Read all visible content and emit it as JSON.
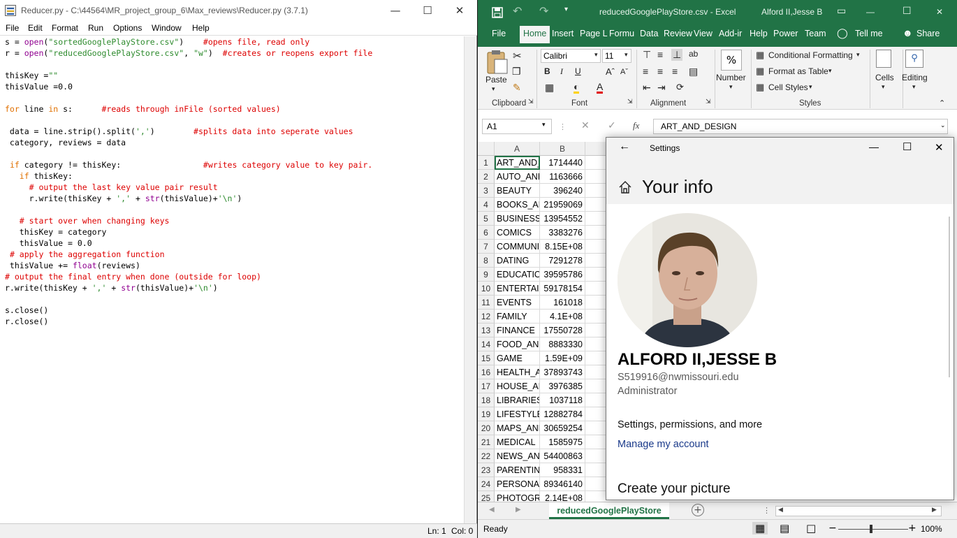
{
  "idle": {
    "title": "Reducer.py - C:\\44564\\MR_project_group_6\\Max_reviews\\Reducer.py (3.7.1)",
    "menu": [
      "File",
      "Edit",
      "Format",
      "Run",
      "Options",
      "Window",
      "Help"
    ],
    "status_ln": "Ln: 1",
    "status_col": "Col: 0",
    "code": [
      [
        [
          "s = ",
          ""
        ],
        [
          "open",
          "bi"
        ],
        [
          "(",
          ""
        ],
        [
          "\"sortedGooglePlayStore.csv\"",
          "str"
        ],
        [
          ")    ",
          ""
        ],
        [
          "#opens file, read only",
          "cmt"
        ]
      ],
      [
        [
          "r = ",
          ""
        ],
        [
          "open",
          "bi"
        ],
        [
          "(",
          ""
        ],
        [
          "\"reducedGooglePlayStore.csv\"",
          "str"
        ],
        [
          ", ",
          ""
        ],
        [
          "\"w\"",
          "str"
        ],
        [
          ")  ",
          ""
        ],
        [
          "#creates or reopens export file",
          "cmt"
        ]
      ],
      [],
      [
        [
          "thisKey =",
          ""
        ],
        [
          "\"\"",
          "str"
        ]
      ],
      [
        [
          "thisValue =0.0",
          ""
        ]
      ],
      [],
      [
        [
          "for",
          "kw"
        ],
        [
          " line ",
          ""
        ],
        [
          "in",
          "kw"
        ],
        [
          " s:      ",
          ""
        ],
        [
          "#reads through inFile (sorted values)",
          "cmt"
        ]
      ],
      [],
      [
        [
          " data = line.strip().split(",
          ""
        ],
        [
          "','",
          "str"
        ],
        [
          ")        ",
          ""
        ],
        [
          "#splits data into seperate values",
          "cmt"
        ]
      ],
      [
        [
          " category, reviews = data",
          ""
        ]
      ],
      [],
      [
        [
          " ",
          ""
        ],
        [
          "if",
          "kw"
        ],
        [
          " category != thisKey:                 ",
          ""
        ],
        [
          "#writes category value to key pair.",
          "cmt"
        ]
      ],
      [
        [
          "   ",
          ""
        ],
        [
          "if",
          "kw"
        ],
        [
          " thisKey:",
          ""
        ]
      ],
      [
        [
          "     ",
          ""
        ],
        [
          "# output the last key value pair result",
          "cmt"
        ]
      ],
      [
        [
          "     r.write(thisKey + ",
          ""
        ],
        [
          "','",
          "str"
        ],
        [
          " + ",
          ""
        ],
        [
          "str",
          "bi"
        ],
        [
          "(thisValue)+",
          ""
        ],
        [
          "'\\n'",
          "str"
        ],
        [
          ")",
          ""
        ]
      ],
      [],
      [
        [
          "   ",
          ""
        ],
        [
          "# start over when changing keys",
          "cmt"
        ]
      ],
      [
        [
          "   thisKey = category",
          ""
        ]
      ],
      [
        [
          "   thisValue = 0.0",
          ""
        ]
      ],
      [
        [
          " ",
          ""
        ],
        [
          "# apply the aggregation function",
          "cmt"
        ]
      ],
      [
        [
          " thisValue += ",
          ""
        ],
        [
          "float",
          "bi"
        ],
        [
          "(reviews)",
          ""
        ]
      ],
      [
        [
          "# output the final entry when done (outside for loop)",
          "cmt"
        ]
      ],
      [
        [
          "r.write(thisKey + ",
          ""
        ],
        [
          "','",
          "str"
        ],
        [
          " + ",
          ""
        ],
        [
          "str",
          "bi"
        ],
        [
          "(thisValue)+",
          ""
        ],
        [
          "'\\n'",
          "str"
        ],
        [
          ")",
          ""
        ]
      ],
      [],
      [
        [
          "s.close()",
          ""
        ]
      ],
      [
        [
          "r.close()",
          ""
        ]
      ]
    ]
  },
  "excel": {
    "file_title": "reducedGooglePlayStore.csv  -  Excel",
    "user": "Alford II,Jesse B",
    "tabs": [
      "File",
      "Home",
      "Insert",
      "Page L",
      "Formu",
      "Data",
      "Review",
      "View",
      "Add-ir",
      "Help",
      "Power",
      "Team",
      "Tell me",
      "Share"
    ],
    "font_name": "Calibri",
    "font_size": "11",
    "paste": "Paste",
    "number": "Number",
    "cond_fmt": "Conditional Formatting",
    "fmt_table": "Format as Table",
    "cell_styles": "Cell Styles",
    "cells": "Cells",
    "editing": "Editing",
    "groups": [
      "Clipboard",
      "Font",
      "Alignment",
      "Styles"
    ],
    "name_box": "A1",
    "formula": "ART_AND_DESIGN",
    "col_headers": [
      "A",
      "B"
    ],
    "rows": [
      [
        "1",
        "ART_AND_DESIGN",
        "1714440"
      ],
      [
        "2",
        "AUTO_AND_VEHICLES",
        "1163666"
      ],
      [
        "3",
        "BEAUTY",
        "396240"
      ],
      [
        "4",
        "BOOKS_AND_REFERENCE",
        "21959069"
      ],
      [
        "5",
        "BUSINESS",
        "13954552"
      ],
      [
        "6",
        "COMICS",
        "3383276"
      ],
      [
        "7",
        "COMMUNICATION",
        "8.15E+08"
      ],
      [
        "8",
        "DATING",
        "7291278"
      ],
      [
        "9",
        "EDUCATION",
        "39595786"
      ],
      [
        "10",
        "ENTERTAINMENT",
        "59178154"
      ],
      [
        "11",
        "EVENTS",
        "161018"
      ],
      [
        "12",
        "FAMILY",
        "4.1E+08"
      ],
      [
        "13",
        "FINANCE",
        "17550728"
      ],
      [
        "14",
        "FOOD_AND_DRINK",
        "8883330"
      ],
      [
        "15",
        "GAME",
        "1.59E+09"
      ],
      [
        "16",
        "HEALTH_AND_FITNESS",
        "37893743"
      ],
      [
        "17",
        "HOUSE_AND_HOME",
        "3976385"
      ],
      [
        "18",
        "LIBRARIES_AND_DEMO",
        "1037118"
      ],
      [
        "19",
        "LIFESTYLE",
        "12882784"
      ],
      [
        "20",
        "MAPS_AND_NAVIGATION",
        "30659254"
      ],
      [
        "21",
        "MEDICAL",
        "1585975"
      ],
      [
        "22",
        "NEWS_AND_MAGAZINES",
        "54400863"
      ],
      [
        "23",
        "PARENTING",
        "958331"
      ],
      [
        "24",
        "PERSONALIZATION",
        "89346140"
      ],
      [
        "25",
        "PHOTOGRAPHY",
        "2.14E+08"
      ]
    ],
    "sheet_tab": "reducedGooglePlayStore",
    "status_ready": "Ready",
    "zoom": "100%"
  },
  "settings": {
    "window_title": "Settings",
    "page_title": "Your info",
    "name": "ALFORD II,JESSE B",
    "email": "S519916@nwmissouri.edu",
    "role": "Administrator",
    "perm_text": "Settings, permissions, and more",
    "manage_link": "Manage my account",
    "create_picture": "Create your picture"
  }
}
